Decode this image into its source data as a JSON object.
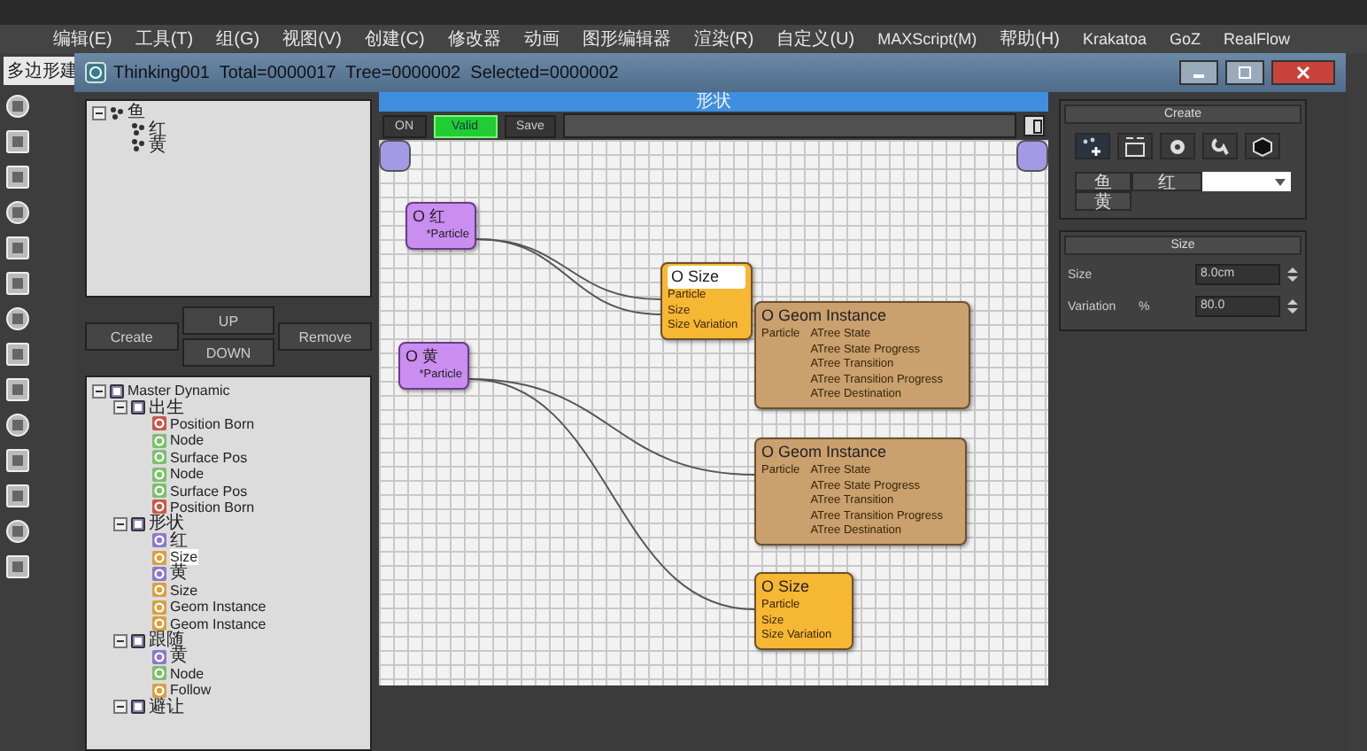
{
  "menu_bar": {
    "items": [
      "编辑(E)",
      "工具(T)",
      "组(G)",
      "视图(V)",
      "创建(C)",
      "修改器",
      "动画",
      "图形编辑器",
      "渲染(R)",
      "自定义(U)",
      "MAXScript(M)",
      "帮助(H)",
      "Krakatoa",
      "GoZ",
      "RealFlow"
    ]
  },
  "ribbon_tab": {
    "label": "多边形建"
  },
  "window": {
    "title": "Thinking001  Total=0000017  Tree=0000002  Selected=0000002"
  },
  "groups_tree": [
    {
      "label": "鱼",
      "expanded": true,
      "selected": false,
      "children": [
        {
          "label": "红",
          "selected": false
        },
        {
          "label": "黄",
          "selected": false
        }
      ]
    }
  ],
  "group_buttons": [
    {
      "label": "Create"
    },
    {
      "label": "UP"
    },
    {
      "label": "DOWN"
    },
    {
      "label": "Remove"
    }
  ],
  "operator_tree": [
    {
      "label": "Master Dynamic",
      "expanded": true,
      "selected": false,
      "children": [
        {
          "label": "出生",
          "expanded": true,
          "selected": false,
          "children": [
            {
              "label": "Position Born",
              "color": "#c8584a",
              "selected": false
            },
            {
              "label": "Node",
              "color": "#7cc06a",
              "selected": false
            },
            {
              "label": "Surface Pos",
              "color": "#7cc06a",
              "selected": false
            },
            {
              "label": "Node",
              "color": "#7cc06a",
              "selected": false
            },
            {
              "label": "Surface Pos",
              "color": "#7cc06a",
              "selected": false
            },
            {
              "label": "Position Born",
              "color": "#c8584a",
              "selected": false
            }
          ]
        },
        {
          "label": "形状",
          "expanded": true,
          "selected": false,
          "children": [
            {
              "label": "红",
              "color": "#8e78c8",
              "selected": false
            },
            {
              "label": "Size",
              "color": "#d9a040",
              "selected": true
            },
            {
              "label": "黄",
              "color": "#8e78c8",
              "selected": false
            },
            {
              "label": "Size",
              "color": "#d9a040",
              "selected": false
            },
            {
              "label": "Geom Instance",
              "color": "#d9a040",
              "selected": false
            },
            {
              "label": "Geom Instance",
              "color": "#d9a040",
              "selected": false
            }
          ]
        },
        {
          "label": "跟随",
          "expanded": true,
          "selected": false,
          "children": [
            {
              "label": "黄",
              "color": "#8e78c8",
              "selected": false
            },
            {
              "label": "Node",
              "color": "#7cc06a",
              "selected": false
            },
            {
              "label": "Follow",
              "color": "#d9a040",
              "selected": false
            }
          ]
        },
        {
          "label": "避让",
          "expanded": true,
          "selected": false
        }
      ]
    }
  ],
  "graph": {
    "title": "形状",
    "toolbar": [
      {
        "label": "ON",
        "kind": "button"
      },
      {
        "label": "Valid",
        "kind": "status"
      },
      {
        "label": "Save",
        "kind": "button"
      }
    ],
    "nodes": [
      {
        "kind": "source",
        "title": "O 红",
        "selected": false,
        "outputs": [
          "*Particle"
        ]
      },
      {
        "kind": "source",
        "title": "O 黄",
        "selected": false,
        "outputs": [
          "*Particle"
        ]
      },
      {
        "kind": "operator",
        "title": "O Size",
        "selected": true,
        "inputs": [
          "Particle",
          "Size",
          "Size Variation"
        ]
      },
      {
        "kind": "geometry",
        "title": "O Geom Instance",
        "selected": false,
        "inputs": [
          "Particle"
        ],
        "outputs": [
          "ATree State",
          "ATree State Progress",
          "ATree Transition",
          "ATree Transition Progress",
          "ATree Destination"
        ]
      },
      {
        "kind": "geometry",
        "title": "O Geom Instance",
        "selected": false,
        "inputs": [
          "Particle"
        ],
        "outputs": [
          "ATree State",
          "ATree State Progress",
          "ATree Transition",
          "ATree Transition Progress",
          "ATree Destination"
        ]
      },
      {
        "kind": "operator",
        "title": "O Size",
        "selected": false,
        "inputs": [
          "Particle",
          "Size",
          "Size Variation"
        ]
      }
    ]
  },
  "create_rollout": {
    "title": "Create",
    "group_tabs": [
      "鱼",
      "红",
      "黄"
    ]
  },
  "size_rollout": {
    "title": "Size",
    "fields": [
      {
        "label": "Size",
        "value": "8.0cm"
      },
      {
        "label": "Variation",
        "unit": "%",
        "value": "80.0"
      }
    ]
  }
}
